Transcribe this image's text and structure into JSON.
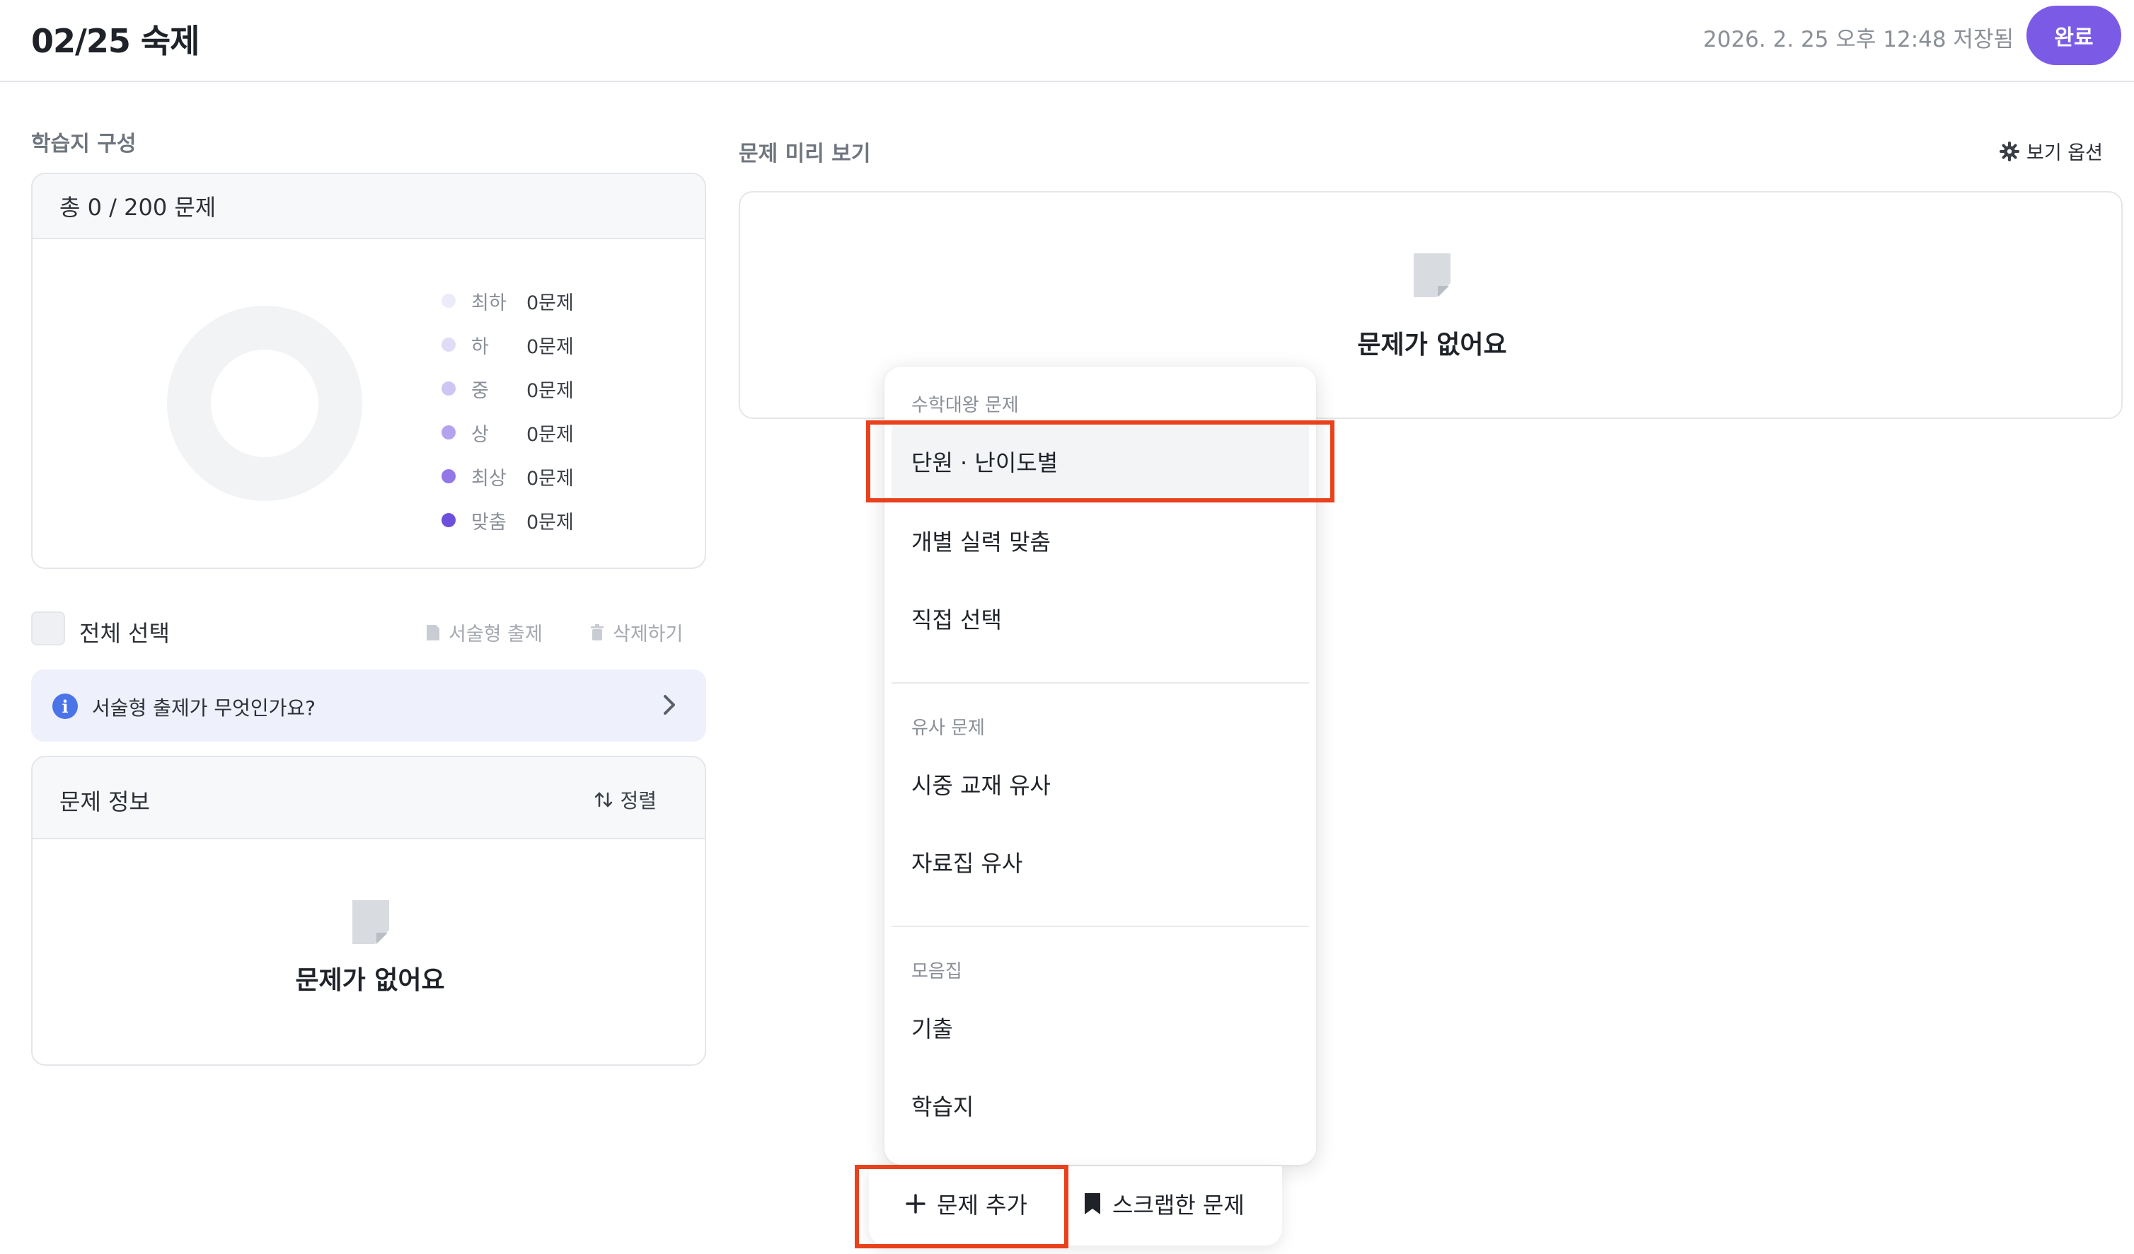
{
  "header": {
    "title": "02/25 숙제",
    "saved_status": "2026. 2. 25 오후 12:48 저장됨",
    "done_label": "완료"
  },
  "composition": {
    "section_label": "학습지 구성",
    "total_text": "총 0 / 200 문제",
    "legend": [
      {
        "name": "최하",
        "count": "0문제",
        "color": "#ecebfa"
      },
      {
        "name": "하",
        "count": "0문제",
        "color": "#e0dcf8"
      },
      {
        "name": "중",
        "count": "0문제",
        "color": "#cfc5f4"
      },
      {
        "name": "상",
        "count": "0문제",
        "color": "#b4a2ee"
      },
      {
        "name": "최상",
        "count": "0문제",
        "color": "#9277e6"
      },
      {
        "name": "맞춤",
        "count": "0문제",
        "color": "#6d4fdc"
      }
    ]
  },
  "selection": {
    "select_all_label": "전체 선택",
    "essay_label": "서술형 출제",
    "delete_label": "삭제하기"
  },
  "info_banner": {
    "icon": "info-icon",
    "text": "서술형 출제가 무엇인가요?"
  },
  "problem_info": {
    "title": "문제 정보",
    "sort_label": "정렬",
    "empty_text": "문제가 없어요"
  },
  "preview": {
    "title": "문제 미리 보기",
    "view_options_label": "보기 옵션",
    "empty_text": "문제가 없어요"
  },
  "dropdown": {
    "groups": [
      {
        "label": "수학대왕 문제",
        "items": [
          "단원 · 난이도별",
          "개별 실력 맞춤",
          "직접 선택"
        ]
      },
      {
        "label": "유사 문제",
        "items": [
          "시중 교재 유사",
          "자료집 유사"
        ]
      },
      {
        "label": "모음집",
        "items": [
          "기출",
          "학습지"
        ]
      }
    ]
  },
  "bottom_bar": {
    "add_label": "문제 추가",
    "scrap_label": "스크랩한 문제"
  },
  "colors": {
    "accent": "#7b5be6",
    "highlight": "#e8411c",
    "info_blue": "#4a74e8"
  }
}
